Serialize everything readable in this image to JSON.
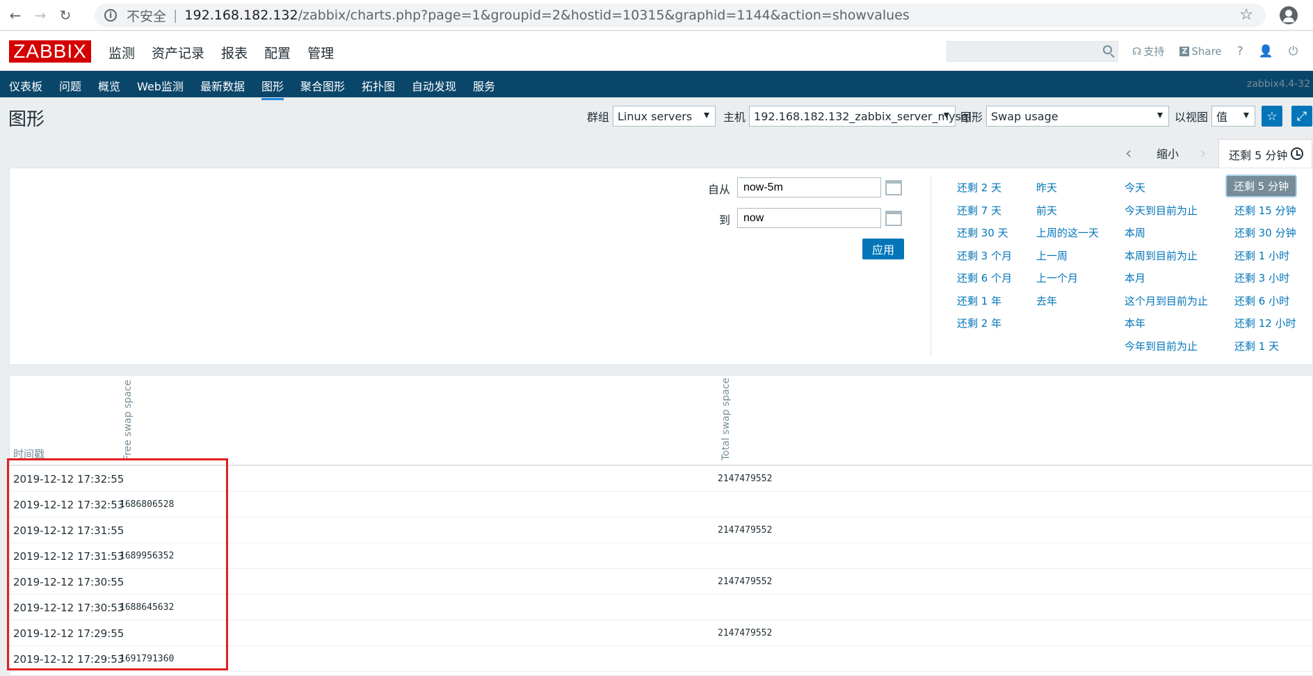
{
  "browser": {
    "insecure_label": "不安全",
    "url_host": "192.168.182.132",
    "url_path": "/zabbix/charts.php?page=1&groupid=2&hostid=10315&graphid=1144&action=showvalues"
  },
  "header": {
    "logo": "ZABBIX",
    "menu": [
      {
        "label": "监测",
        "active": true
      },
      {
        "label": "资产记录"
      },
      {
        "label": "报表"
      },
      {
        "label": "配置"
      },
      {
        "label": "管理"
      }
    ],
    "support_label": "支持",
    "share_label": "Share",
    "help_label": "?"
  },
  "subnav": {
    "items": [
      {
        "label": "仪表板"
      },
      {
        "label": "问题"
      },
      {
        "label": "概览"
      },
      {
        "label": "Web监测"
      },
      {
        "label": "最新数据"
      },
      {
        "label": "图形",
        "active": true
      },
      {
        "label": "聚合图形"
      },
      {
        "label": "拓扑图"
      },
      {
        "label": "自动发现"
      },
      {
        "label": "服务"
      }
    ],
    "version": "zabbix4.4-32"
  },
  "page": {
    "title": "图形",
    "group_label": "群组",
    "group_value": "Linux servers",
    "host_label": "主机",
    "host_value": "192.168.182.132_zabbix_server_mysql",
    "graph_label": "图形",
    "graph_value": "Swap usage",
    "view_label": "以视图",
    "view_value": "值"
  },
  "time": {
    "zoom_out": "缩小",
    "selected_tab": "还剩 5 分钟",
    "from_label": "自从",
    "from_value": "now-5m",
    "to_label": "到",
    "to_value": "now",
    "apply_label": "应用",
    "quick_col1": [
      "还剩 2 天",
      "还剩 7 天",
      "还剩 30 天",
      "还剩 3 个月",
      "还剩 6 个月",
      "还剩 1 年",
      "还剩 2 年"
    ],
    "quick_col2": [
      "昨天",
      "前天",
      "上周的这一天",
      "上一周",
      "上一个月",
      "去年"
    ],
    "quick_col3": [
      "今天",
      "今天到目前为止",
      "本周",
      "本周到目前为止",
      "本月",
      "这个月到目前为止",
      "本年",
      "今年到目前为止"
    ],
    "quick_col4": [
      "还剩 5 分钟",
      "还剩 15 分钟",
      "还剩 30 分钟",
      "还剩 1 小时",
      "还剩 3 小时",
      "还剩 6 小时",
      "还剩 12 小时",
      "还剩 1 天"
    ]
  },
  "table": {
    "col_time": "时间戳",
    "col_free": "Free swap space",
    "col_total": "Total swap space",
    "rows": [
      {
        "time": "2019-12-12 17:32:55",
        "free": "",
        "total": "2147479552"
      },
      {
        "time": "2019-12-12 17:32:53",
        "free": "1686806528",
        "total": ""
      },
      {
        "time": "2019-12-12 17:31:55",
        "free": "",
        "total": "2147479552"
      },
      {
        "time": "2019-12-12 17:31:53",
        "free": "1689956352",
        "total": ""
      },
      {
        "time": "2019-12-12 17:30:55",
        "free": "",
        "total": "2147479552"
      },
      {
        "time": "2019-12-12 17:30:53",
        "free": "1688645632",
        "total": ""
      },
      {
        "time": "2019-12-12 17:29:55",
        "free": "",
        "total": "2147479552"
      },
      {
        "time": "2019-12-12 17:29:53",
        "free": "1691791360",
        "total": ""
      }
    ]
  }
}
